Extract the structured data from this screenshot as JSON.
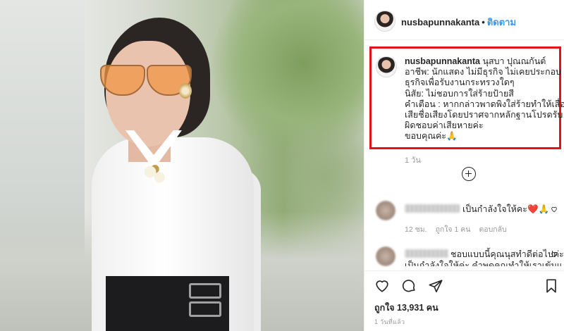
{
  "header": {
    "username": "nusbapunnakanta",
    "separator": "•",
    "follow_label": "ติดตาม"
  },
  "caption": {
    "username": "nusbapunnakanta",
    "lines": [
      "นุสบา ปุณณกันต์",
      "อาชีพ: นักแสดง ไม่มีธุรกิจ ไม่เคยประกอบ",
      "ธุรกิจเพื่อรับงานกระทรวงใดๆ",
      "นิสัย: ไม่ชอบการใส่ร้ายป้ายสี",
      "คำเตือน : หากกล่าวพาดพิงใส่ร้ายทำให้เสื่อม",
      "เสียชื่อเสียงโดยปราศจากหลักฐานโปรดรับ",
      "ผิดชอบค่าเสียหายค่ะ",
      "ขอบคุณค่ะ🙏"
    ],
    "time": "1 วัน",
    "highlight_color": "#e0141a"
  },
  "comments": [
    {
      "text": "เป็นกำลังใจให้คะ❤️🙏",
      "meta": {
        "time": "12 ชม.",
        "likes": "ถูกใจ 1 คน",
        "reply": "ตอบกลับ"
      }
    },
    {
      "text": "ชอบแบบนี้คุณนุสทำดีต่อไปค่ะ",
      "text_cont": "เป็นกำลังใจให้ค่ะ คำพูดคุณทำให้เราเข้มแข็ง"
    }
  ],
  "actions": {
    "icons": [
      "heart-icon",
      "comment-icon",
      "share-icon",
      "bookmark-icon"
    ],
    "likes": "ถูกใจ 13,931 คน",
    "date": "1 วันที่แล้ว"
  },
  "colors": {
    "link_blue": "#3897f0",
    "text": "#262626",
    "muted": "#999999",
    "border": "#efefef"
  }
}
